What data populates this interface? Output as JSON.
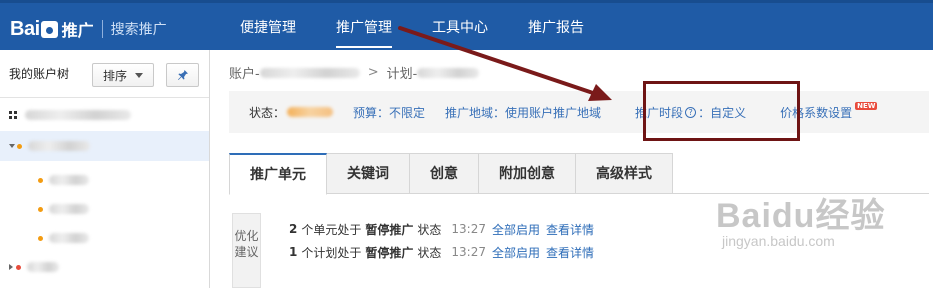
{
  "header": {
    "logo_text": "Bai",
    "logo_text2": "推广",
    "product": "搜索推广",
    "nav": [
      {
        "label": "便捷管理",
        "active": false
      },
      {
        "label": "推广管理",
        "active": true
      },
      {
        "label": "工具中心",
        "active": false
      },
      {
        "label": "推广报告",
        "active": false
      }
    ]
  },
  "sidebar": {
    "title": "我的账户树",
    "sort_label": "排序",
    "pin_icon": "pin-icon"
  },
  "main": {
    "breadcrumb": {
      "account_label": "账户-",
      "plan_label": "计划-"
    },
    "info": {
      "status_label": "状态：",
      "budget": "预算：不限定",
      "region": "推广地域：使用账户推广地域",
      "schedule_label": "推广时段",
      "schedule_value": "：自定义",
      "price_factor": "价格系数设置",
      "new_badge": "NEW"
    },
    "tabs": [
      {
        "label": "推广单元",
        "active": true
      },
      {
        "label": "关键词",
        "active": false
      },
      {
        "label": "创意",
        "active": false
      },
      {
        "label": "附加创意",
        "active": false
      },
      {
        "label": "高级样式",
        "active": false
      }
    ],
    "suggest": {
      "label": "优化建议",
      "rows": [
        {
          "num": "2",
          "text1": "个单元处于",
          "status": "暂停推广",
          "text2": "状态",
          "time": "13:27",
          "link1": "全部启用",
          "link2": "查看详情"
        },
        {
          "num": "1",
          "text1": "个计划处于",
          "status": "暂停推广",
          "text2": "状态",
          "time": "13:27",
          "link1": "全部启用",
          "link2": "查看详情"
        }
      ]
    }
  },
  "watermark": {
    "big": "Baidu经验",
    "small": "jingyan.baidu.com"
  },
  "colors": {
    "nav_bg": "#1f5ba6",
    "link": "#3870b8",
    "highlight": "#6e1414",
    "badge": "#e94b3c"
  }
}
